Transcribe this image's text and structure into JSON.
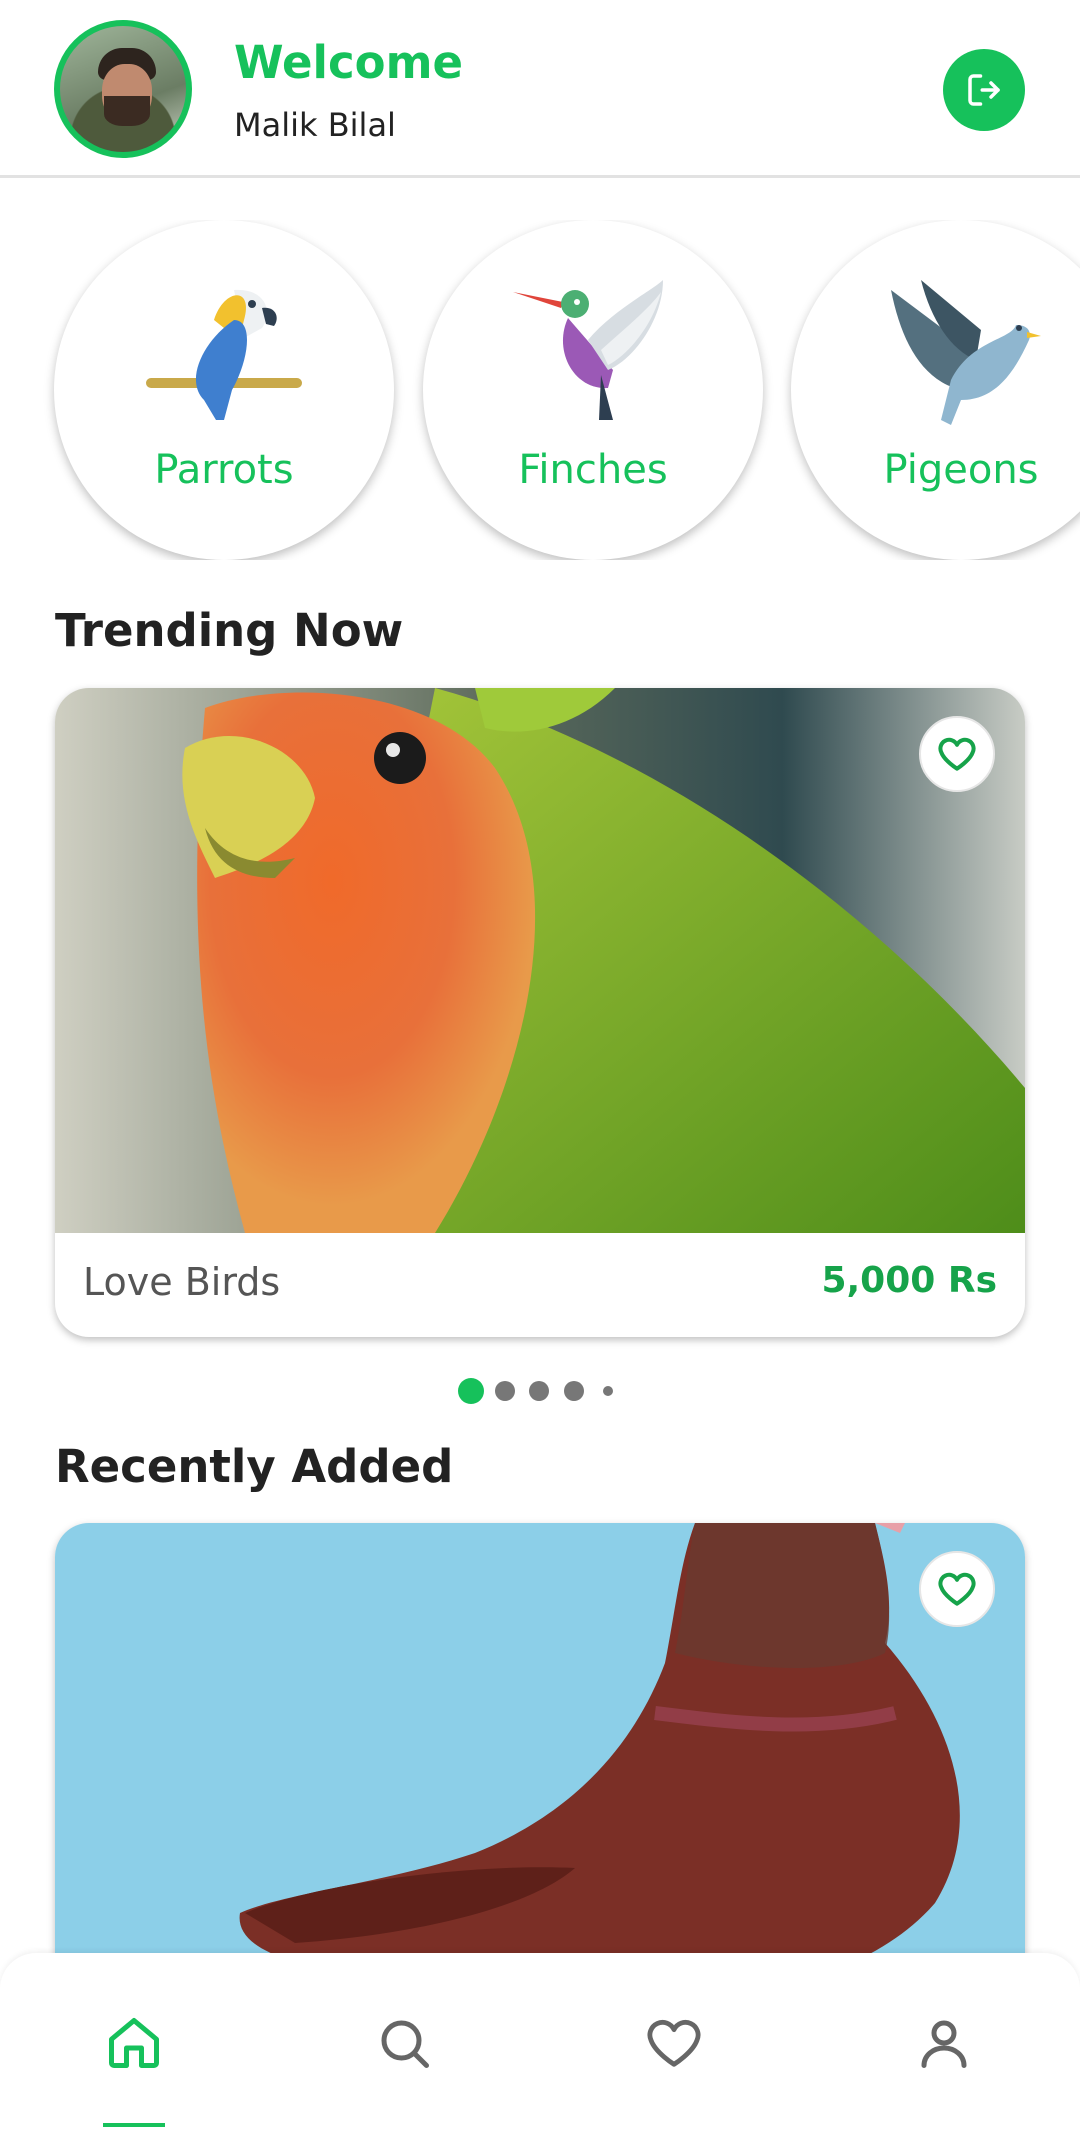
{
  "header": {
    "welcome": "Welcome",
    "username": "Malik Bilal",
    "logout_icon": "logout-icon"
  },
  "categories": [
    {
      "label": "Parrots",
      "icon": "parrot-icon"
    },
    {
      "label": "Finches",
      "icon": "hummingbird-icon"
    },
    {
      "label": "Pigeons",
      "icon": "dove-icon"
    }
  ],
  "sections": {
    "trending": "Trending Now",
    "recent": "Recently Added"
  },
  "trending_card": {
    "name": "Love Birds",
    "price": "5,000 Rs",
    "image": "lovebird-photo"
  },
  "recent_card": {
    "image": "red-pigeon-photo"
  },
  "carousel": {
    "count": 5,
    "active": 0
  },
  "nav": [
    {
      "icon": "home-icon",
      "active": true
    },
    {
      "icon": "search-icon",
      "active": false
    },
    {
      "icon": "heart-icon",
      "active": false
    },
    {
      "icon": "profile-icon",
      "active": false
    }
  ],
  "colors": {
    "accent": "#16c15b",
    "price": "#16a34a",
    "inactive_icon": "#666666"
  }
}
